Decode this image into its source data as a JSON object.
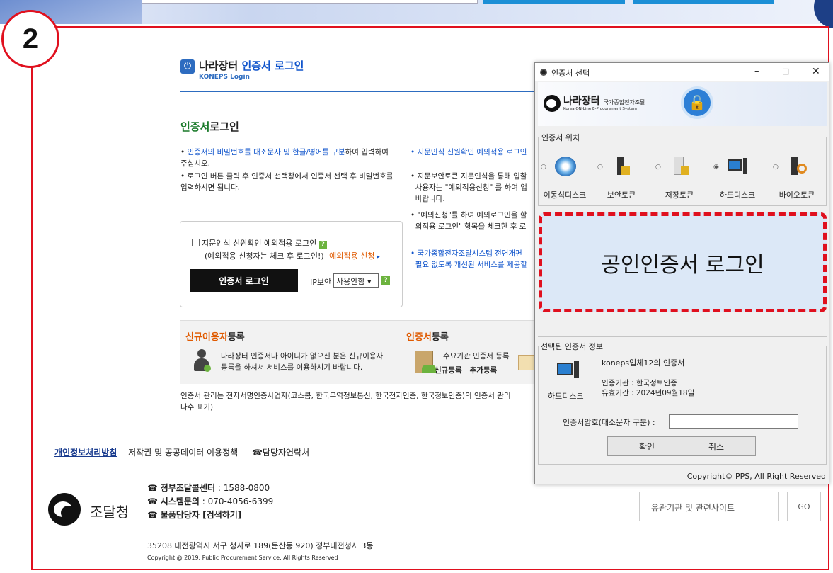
{
  "step_number": "2",
  "page": {
    "login_title_prefix": "나라장터 ",
    "login_title_main": "인증서 로그인",
    "login_title_sub": "KONEPS Login",
    "section_title_a": "인증서",
    "section_title_b": "로그인",
    "bullets_left": [
      {
        "parts": [
          "인증서의 비밀번호를 대소문자 및 한글/영어를 구분",
          "하여 입력하여 주십시오."
        ]
      },
      {
        "parts": [
          "로그인 버튼 클릭 후 인증서 선택창에서 인증서 선택 후 비밀번호를 입력하시면 됩니다."
        ]
      }
    ],
    "bullets_right": [
      "지문인식 신원확인 예외적용 로그인",
      "지문보안토큰 지문인식을 통해 입찰",
      "사용자는 \"예외적용신청\" 를 하여 업",
      "바랍니다.",
      "\"예외신청\"를 하여 예외로그인을 할",
      "외적용 로그인\" 항목을 체크한 후 로",
      "국가종합전자조달시스템 전면개편",
      "필요 없도록 개선된 서비스를 제공할"
    ],
    "checkbox_label": "지문인식 신원확인 예외적용 로그인",
    "checkbox_note": "(예외적용 신청자는 체크 후 로그인!)",
    "exception_link": "예외적용 신청",
    "login_button": "인증서 로그인",
    "ip_label": "IP보안",
    "ip_select": "사용안함",
    "help_q": "?",
    "new_user_title_a": "신규이용자",
    "new_user_title_b": "등록",
    "new_user_desc_1": "나라장터 인증서나 아이디가 없으신 분은 신규이용자",
    "new_user_desc_2": "등록을 하셔서 서비스를 이용하시기 바랍니다.",
    "cert_reg_title_a": "인증서",
    "cert_reg_title_b": "등록",
    "cert_reg_desc": "수요기관 인증서 등록",
    "cert_reg_link1": "신규등록",
    "cert_reg_link2": "추가등록",
    "mgmt_note_1": "인증서 관리는 전자서명인증사업자(코스콤, 한국무역정보통신, 한국전자인증, 한국정보인증)의 인증서 관리",
    "mgmt_note_2": "다수 표기)",
    "footer_links": [
      "개인정보처리방침",
      "저작권 및 공공데이터 이용정책",
      "담당자연락처"
    ],
    "org_name": "조달청",
    "contacts": [
      {
        "label": "정부조달콜센터",
        "value": " : 1588-0800"
      },
      {
        "label": "시스템문의",
        "value": " : 070-4056-6399"
      },
      {
        "label": "물품담당자",
        "value": " [검색하기]"
      }
    ],
    "address": "35208 대전광역시 서구 청사로 189(둔산동 920) 정부대전청사 3동",
    "copyright": "Copyright @ 2019. Public Procurement Service. All Rights Reserved",
    "related_sites": "유관기관 및 관련사이트",
    "go": "GO"
  },
  "dialog": {
    "title": "인증서 선택",
    "brand_main": "나라장터",
    "brand_small": "국가종합전자조달",
    "brand_sub": "Korea ON-Line E-Procurement System",
    "location_label": "인증서 위치",
    "locations": [
      "이동식디스크",
      "보안토큰",
      "저장토큰",
      "하드디스크",
      "바이오토큰"
    ],
    "selected_location_index": 3,
    "overlay_text": "공인인증서 로그인",
    "selected_info_label": "선택된 인증서 정보",
    "cert_name": "koneps업체12의 인증서",
    "cert_issuer": "인증기관 : 한국정보인증",
    "cert_expiry": "유효기간 : 2024년09월18일",
    "cert_drive": "하드디스크",
    "password_label": "인증서암호(대소문자 구분) :",
    "confirm": "확인",
    "cancel": "취소",
    "copyright": "Copyright© PPS, All Right Reserved"
  },
  "colors": {
    "accent_red": "#e0101e",
    "link_blue": "#1155cc",
    "orange": "#e05a00"
  }
}
